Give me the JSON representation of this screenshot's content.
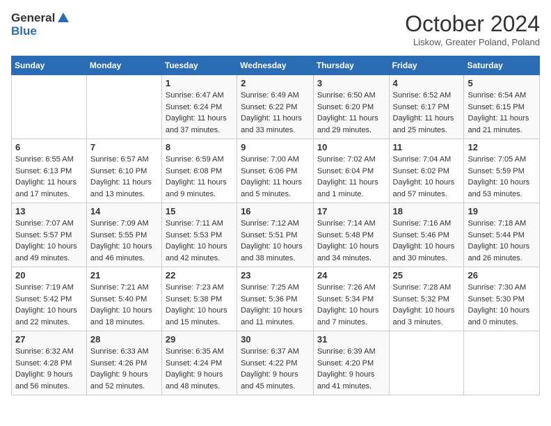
{
  "logo": {
    "text_general": "General",
    "text_blue": "Blue"
  },
  "header": {
    "month": "October 2024",
    "location": "Liskow, Greater Poland, Poland"
  },
  "weekdays": [
    "Sunday",
    "Monday",
    "Tuesday",
    "Wednesday",
    "Thursday",
    "Friday",
    "Saturday"
  ],
  "weeks": [
    [
      {
        "day": "",
        "sunrise": "",
        "sunset": "",
        "daylight": ""
      },
      {
        "day": "",
        "sunrise": "",
        "sunset": "",
        "daylight": ""
      },
      {
        "day": "1",
        "sunrise": "Sunrise: 6:47 AM",
        "sunset": "Sunset: 6:24 PM",
        "daylight": "Daylight: 11 hours and 37 minutes."
      },
      {
        "day": "2",
        "sunrise": "Sunrise: 6:49 AM",
        "sunset": "Sunset: 6:22 PM",
        "daylight": "Daylight: 11 hours and 33 minutes."
      },
      {
        "day": "3",
        "sunrise": "Sunrise: 6:50 AM",
        "sunset": "Sunset: 6:20 PM",
        "daylight": "Daylight: 11 hours and 29 minutes."
      },
      {
        "day": "4",
        "sunrise": "Sunrise: 6:52 AM",
        "sunset": "Sunset: 6:17 PM",
        "daylight": "Daylight: 11 hours and 25 minutes."
      },
      {
        "day": "5",
        "sunrise": "Sunrise: 6:54 AM",
        "sunset": "Sunset: 6:15 PM",
        "daylight": "Daylight: 11 hours and 21 minutes."
      }
    ],
    [
      {
        "day": "6",
        "sunrise": "Sunrise: 6:55 AM",
        "sunset": "Sunset: 6:13 PM",
        "daylight": "Daylight: 11 hours and 17 minutes."
      },
      {
        "day": "7",
        "sunrise": "Sunrise: 6:57 AM",
        "sunset": "Sunset: 6:10 PM",
        "daylight": "Daylight: 11 hours and 13 minutes."
      },
      {
        "day": "8",
        "sunrise": "Sunrise: 6:59 AM",
        "sunset": "Sunset: 6:08 PM",
        "daylight": "Daylight: 11 hours and 9 minutes."
      },
      {
        "day": "9",
        "sunrise": "Sunrise: 7:00 AM",
        "sunset": "Sunset: 6:06 PM",
        "daylight": "Daylight: 11 hours and 5 minutes."
      },
      {
        "day": "10",
        "sunrise": "Sunrise: 7:02 AM",
        "sunset": "Sunset: 6:04 PM",
        "daylight": "Daylight: 11 hours and 1 minute."
      },
      {
        "day": "11",
        "sunrise": "Sunrise: 7:04 AM",
        "sunset": "Sunset: 6:02 PM",
        "daylight": "Daylight: 10 hours and 57 minutes."
      },
      {
        "day": "12",
        "sunrise": "Sunrise: 7:05 AM",
        "sunset": "Sunset: 5:59 PM",
        "daylight": "Daylight: 10 hours and 53 minutes."
      }
    ],
    [
      {
        "day": "13",
        "sunrise": "Sunrise: 7:07 AM",
        "sunset": "Sunset: 5:57 PM",
        "daylight": "Daylight: 10 hours and 49 minutes."
      },
      {
        "day": "14",
        "sunrise": "Sunrise: 7:09 AM",
        "sunset": "Sunset: 5:55 PM",
        "daylight": "Daylight: 10 hours and 46 minutes."
      },
      {
        "day": "15",
        "sunrise": "Sunrise: 7:11 AM",
        "sunset": "Sunset: 5:53 PM",
        "daylight": "Daylight: 10 hours and 42 minutes."
      },
      {
        "day": "16",
        "sunrise": "Sunrise: 7:12 AM",
        "sunset": "Sunset: 5:51 PM",
        "daylight": "Daylight: 10 hours and 38 minutes."
      },
      {
        "day": "17",
        "sunrise": "Sunrise: 7:14 AM",
        "sunset": "Sunset: 5:48 PM",
        "daylight": "Daylight: 10 hours and 34 minutes."
      },
      {
        "day": "18",
        "sunrise": "Sunrise: 7:16 AM",
        "sunset": "Sunset: 5:46 PM",
        "daylight": "Daylight: 10 hours and 30 minutes."
      },
      {
        "day": "19",
        "sunrise": "Sunrise: 7:18 AM",
        "sunset": "Sunset: 5:44 PM",
        "daylight": "Daylight: 10 hours and 26 minutes."
      }
    ],
    [
      {
        "day": "20",
        "sunrise": "Sunrise: 7:19 AM",
        "sunset": "Sunset: 5:42 PM",
        "daylight": "Daylight: 10 hours and 22 minutes."
      },
      {
        "day": "21",
        "sunrise": "Sunrise: 7:21 AM",
        "sunset": "Sunset: 5:40 PM",
        "daylight": "Daylight: 10 hours and 18 minutes."
      },
      {
        "day": "22",
        "sunrise": "Sunrise: 7:23 AM",
        "sunset": "Sunset: 5:38 PM",
        "daylight": "Daylight: 10 hours and 15 minutes."
      },
      {
        "day": "23",
        "sunrise": "Sunrise: 7:25 AM",
        "sunset": "Sunset: 5:36 PM",
        "daylight": "Daylight: 10 hours and 11 minutes."
      },
      {
        "day": "24",
        "sunrise": "Sunrise: 7:26 AM",
        "sunset": "Sunset: 5:34 PM",
        "daylight": "Daylight: 10 hours and 7 minutes."
      },
      {
        "day": "25",
        "sunrise": "Sunrise: 7:28 AM",
        "sunset": "Sunset: 5:32 PM",
        "daylight": "Daylight: 10 hours and 3 minutes."
      },
      {
        "day": "26",
        "sunrise": "Sunrise: 7:30 AM",
        "sunset": "Sunset: 5:30 PM",
        "daylight": "Daylight: 10 hours and 0 minutes."
      }
    ],
    [
      {
        "day": "27",
        "sunrise": "Sunrise: 6:32 AM",
        "sunset": "Sunset: 4:28 PM",
        "daylight": "Daylight: 9 hours and 56 minutes."
      },
      {
        "day": "28",
        "sunrise": "Sunrise: 6:33 AM",
        "sunset": "Sunset: 4:26 PM",
        "daylight": "Daylight: 9 hours and 52 minutes."
      },
      {
        "day": "29",
        "sunrise": "Sunrise: 6:35 AM",
        "sunset": "Sunset: 4:24 PM",
        "daylight": "Daylight: 9 hours and 48 minutes."
      },
      {
        "day": "30",
        "sunrise": "Sunrise: 6:37 AM",
        "sunset": "Sunset: 4:22 PM",
        "daylight": "Daylight: 9 hours and 45 minutes."
      },
      {
        "day": "31",
        "sunrise": "Sunrise: 6:39 AM",
        "sunset": "Sunset: 4:20 PM",
        "daylight": "Daylight: 9 hours and 41 minutes."
      },
      {
        "day": "",
        "sunrise": "",
        "sunset": "",
        "daylight": ""
      },
      {
        "day": "",
        "sunrise": "",
        "sunset": "",
        "daylight": ""
      }
    ]
  ]
}
